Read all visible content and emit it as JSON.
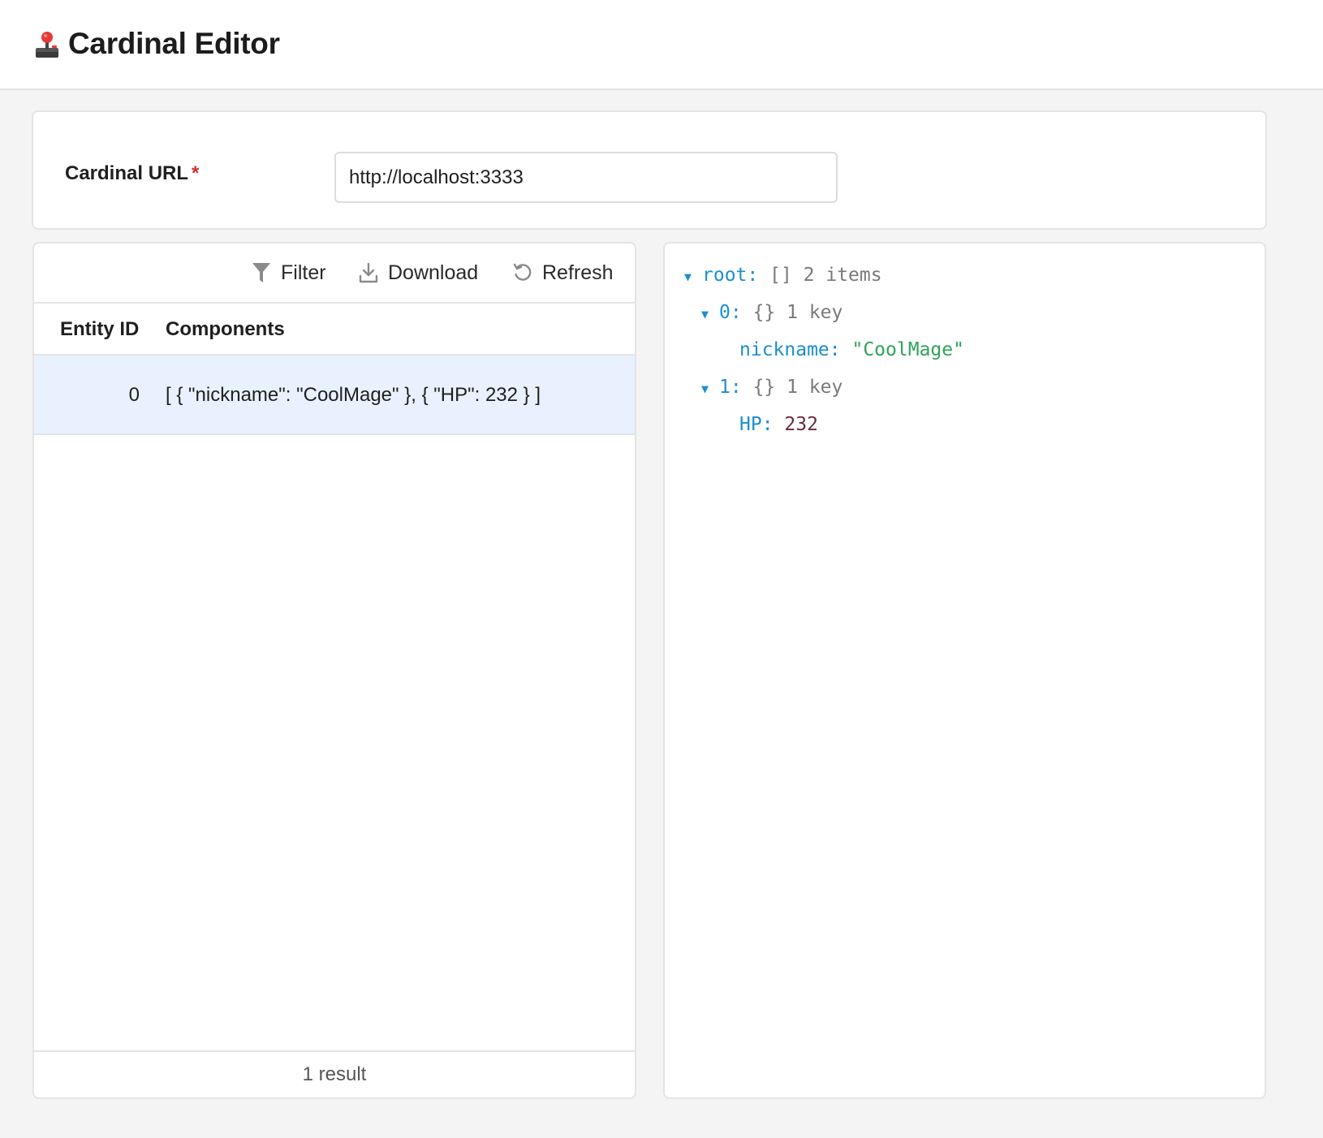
{
  "app": {
    "title": "Cardinal Editor",
    "logo_icon": "joystick-icon"
  },
  "url_field": {
    "label": "Cardinal URL",
    "required_mark": "*",
    "value": "http://localhost:3333"
  },
  "toolbar": {
    "filter_label": "Filter",
    "download_label": "Download",
    "refresh_label": "Refresh"
  },
  "table": {
    "columns": [
      "Entity ID",
      "Components"
    ],
    "rows": [
      {
        "id": "0",
        "components": "[ { \"nickname\": \"CoolMage\" }, { \"HP\": 232 } ]"
      }
    ],
    "footer": "1 result"
  },
  "json_view": {
    "root_key": "root:",
    "root_brace": "[]",
    "root_meta": "2 items",
    "items": [
      {
        "key": "0:",
        "brace": "{}",
        "meta": "1 key",
        "child_key": "nickname:",
        "child_value": "\"CoolMage\""
      },
      {
        "key": "1:",
        "brace": "{}",
        "meta": "1 key",
        "child_key": "HP:",
        "child_value": "232"
      }
    ],
    "caret": "▼"
  },
  "colors": {
    "accent": "#1b8fd1",
    "string": "#2fa35a",
    "number": "#6b2a3a",
    "selected_row": "#e8f1fd",
    "required": "#d32f2f"
  }
}
